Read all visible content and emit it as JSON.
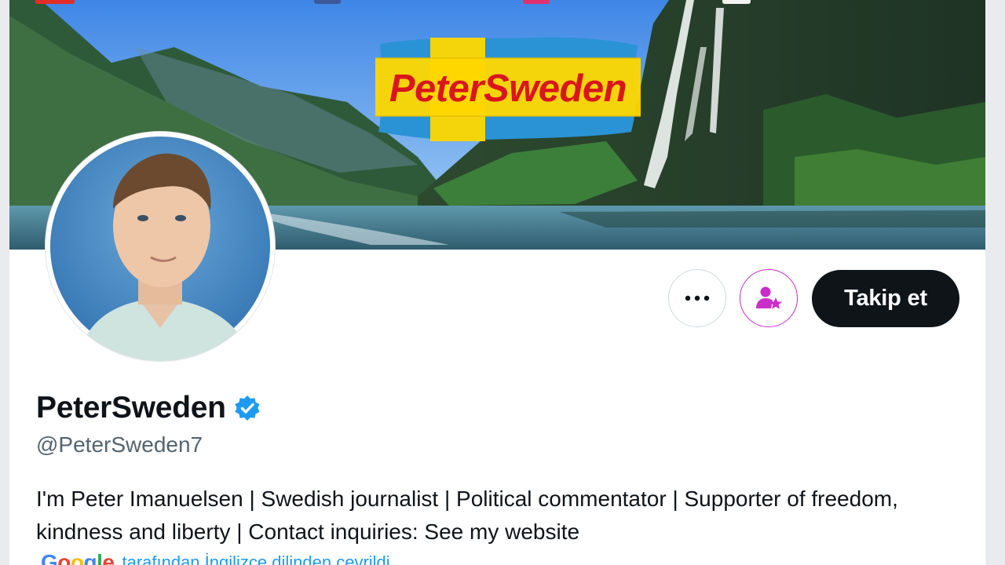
{
  "top_icons": [
    {
      "name": "youtube-icon",
      "color": "#e52d27"
    },
    {
      "name": "facebook-icon",
      "color": "#3b5998"
    },
    {
      "name": "instagram-icon",
      "color": "#e1306c"
    },
    {
      "name": "x-icon",
      "color": "#ffffff"
    }
  ],
  "banner": {
    "logo_text": "PeterSweden",
    "logo_colors": {
      "blue": "#2a93d5",
      "yellow": "#ffd700",
      "text": "#d9161c"
    }
  },
  "actions": {
    "more_icon": "more-horizontal-icon",
    "subscribe_icon": "person-star-icon",
    "subscribe_color": "#c92ec9",
    "follow_label": "Takip et"
  },
  "profile": {
    "display_name": "PeterSweden",
    "verified_icon": "verified-badge-icon",
    "verified_color": "#1d9bf0",
    "handle": "@PeterSweden7",
    "bio": "I'm Peter Imanuelsen | Swedish journalist | Political commentator | Supporter of freedom, kindness and liberty | Contact inquiries: See my website"
  },
  "translation": {
    "provider": "Google",
    "text": "tarafından İngilizce dilinden çevrildi"
  }
}
